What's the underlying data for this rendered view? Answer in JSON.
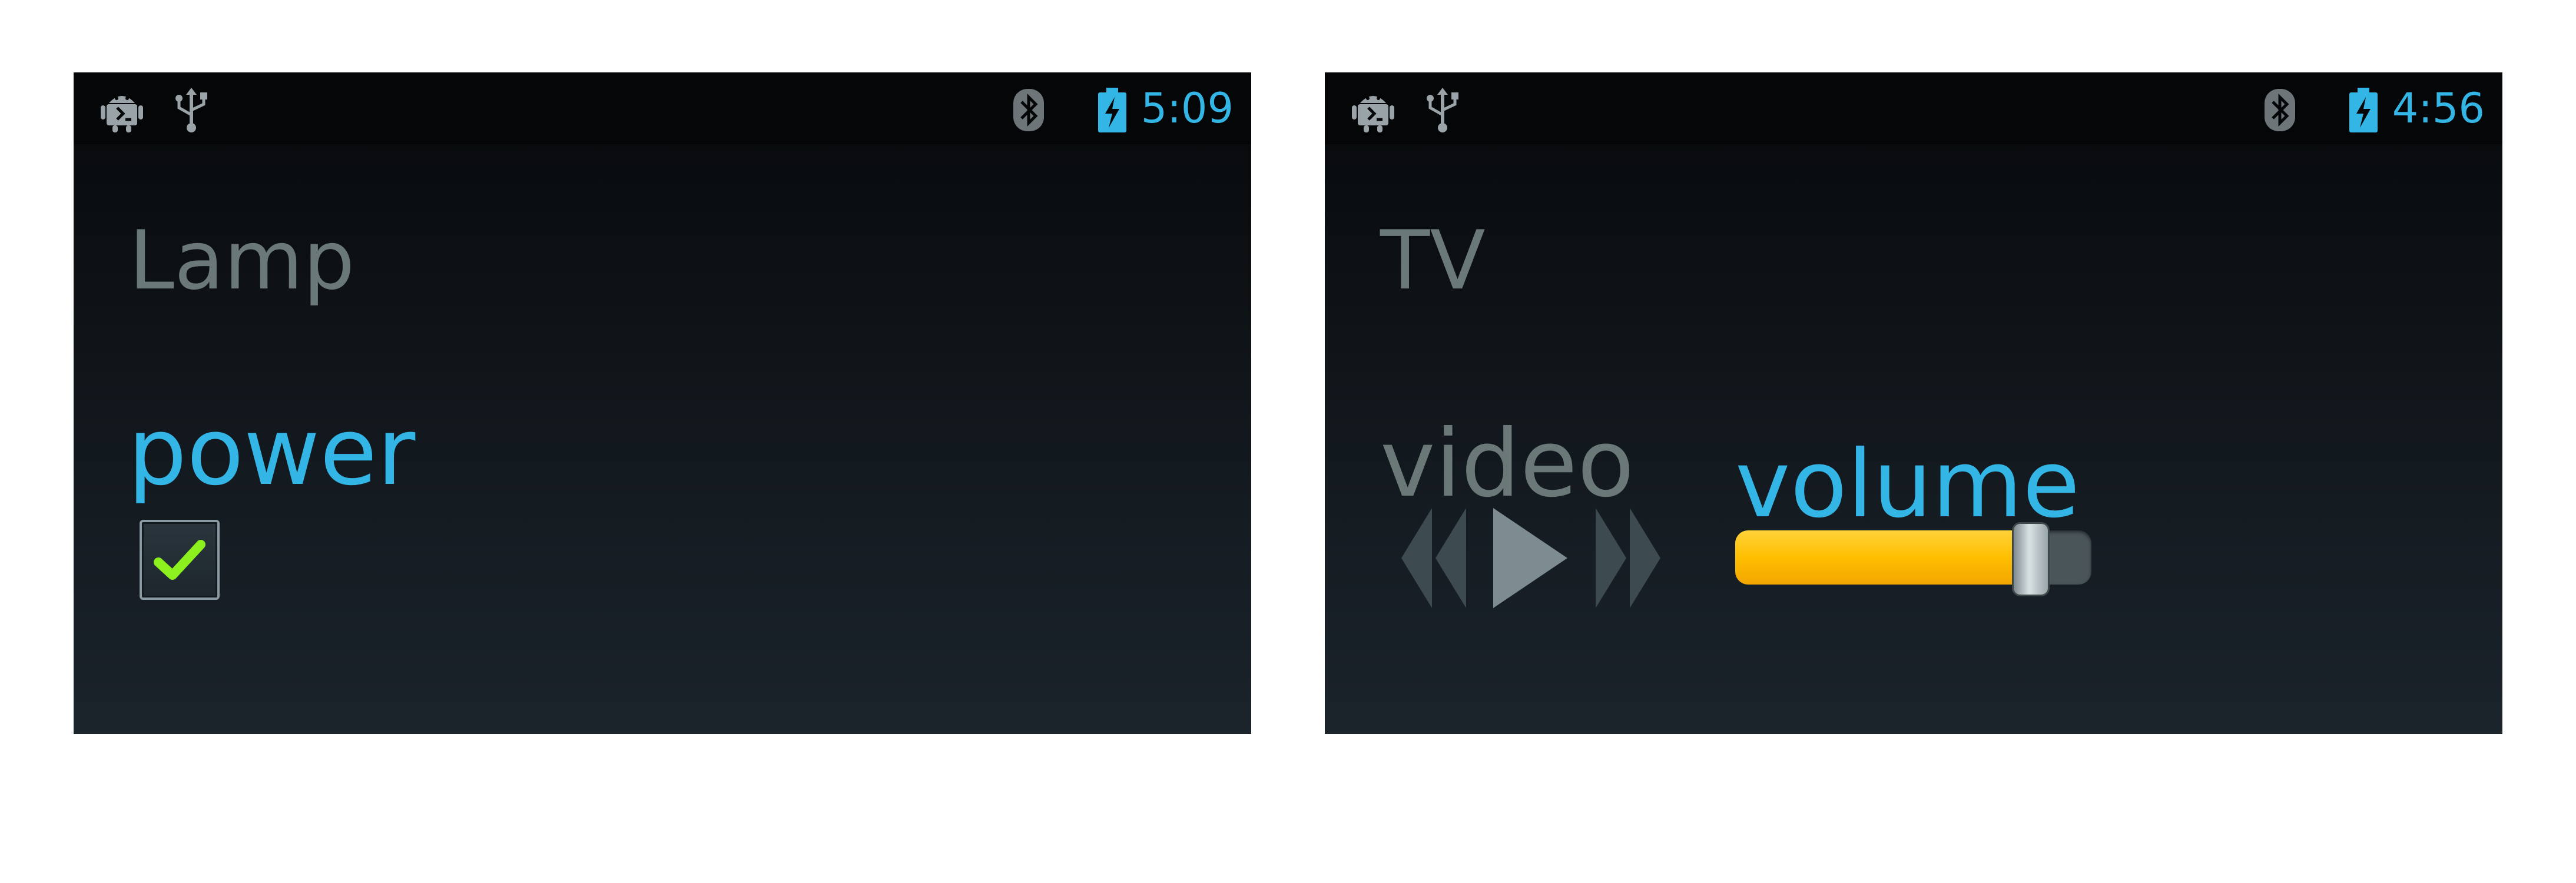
{
  "screens": [
    {
      "device_title": "Lamp",
      "status_time": "5:09",
      "control_label": "power",
      "power_checked": true
    },
    {
      "device_title": "TV",
      "status_time": "4:56",
      "video_label": "video",
      "volume_label": "volume",
      "volume_level": 0.83
    }
  ],
  "status_icons": [
    "android-debug-icon",
    "usb-icon",
    "bluetooth-icon",
    "battery-charging-icon"
  ],
  "media_controls": [
    "rewind-icon",
    "play-icon",
    "fast-forward-icon"
  ],
  "colors": {
    "accent": "#33b5e5",
    "inactive_text": "#6b7878",
    "check_green": "#8cf01e",
    "slider_fill": "#ffbf00"
  }
}
